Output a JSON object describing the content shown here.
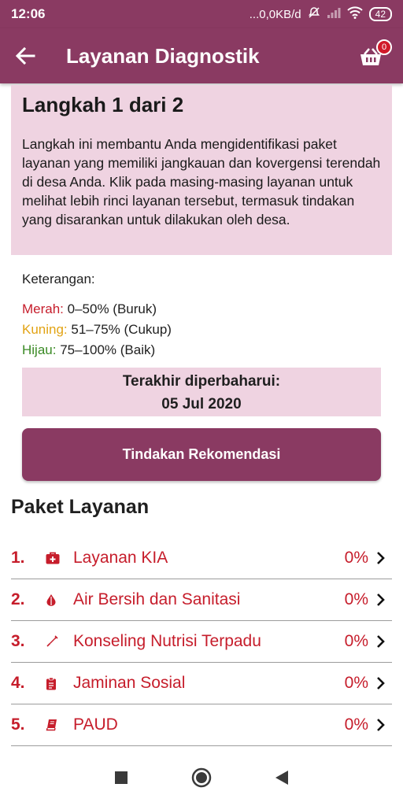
{
  "status_bar": {
    "time": "12:06",
    "network": "...0,0KB/d",
    "battery": "42"
  },
  "app_bar": {
    "title": "Layanan Diagnostik",
    "cart_count": "0"
  },
  "step": {
    "title": "Langkah 1 dari 2",
    "description": "Langkah ini membantu Anda mengidentifikasi paket layanan yang memiliki jangkauan dan kovergensi terendah di desa Anda. Klik pada masing-masing layanan untuk melihat lebih rinci layanan tersebut, termasuk tindakan yang disarankan untuk dilakukan oleh desa."
  },
  "legend": {
    "title": "Keterangan:",
    "items": [
      {
        "label": "Merah:",
        "range": " 0–50% (Buruk)",
        "color": "#c61d2b"
      },
      {
        "label": "Kuning:",
        "range": " 51–75% (Cukup)",
        "color": "#e2a313"
      },
      {
        "label": "Hijau:",
        "range": " 75–100% (Baik)",
        "color": "#3a8a25"
      }
    ]
  },
  "updated": {
    "label": "Terakhir diperbaharui:",
    "date": "05 Jul 2020"
  },
  "recommend_button": "Tindakan Rekomendasi",
  "section_title": "Paket Layanan",
  "services": [
    {
      "num": "1.",
      "icon": "medkit-icon",
      "label": "Layanan KIA",
      "percent": "0%"
    },
    {
      "num": "2.",
      "icon": "water-drop-icon",
      "label": "Air Bersih dan Sanitasi",
      "percent": "0%"
    },
    {
      "num": "3.",
      "icon": "syringe-icon",
      "label": "Konseling Nutrisi Terpadu",
      "percent": "0%"
    },
    {
      "num": "4.",
      "icon": "clipboard-icon",
      "label": "Jaminan Sosial",
      "percent": "0%"
    },
    {
      "num": "5.",
      "icon": "book-icon",
      "label": "PAUD",
      "percent": "0%"
    }
  ],
  "colors": {
    "brand": "#8a3a62",
    "panel": "#efd3e1",
    "service_text": "#c61d2b"
  }
}
